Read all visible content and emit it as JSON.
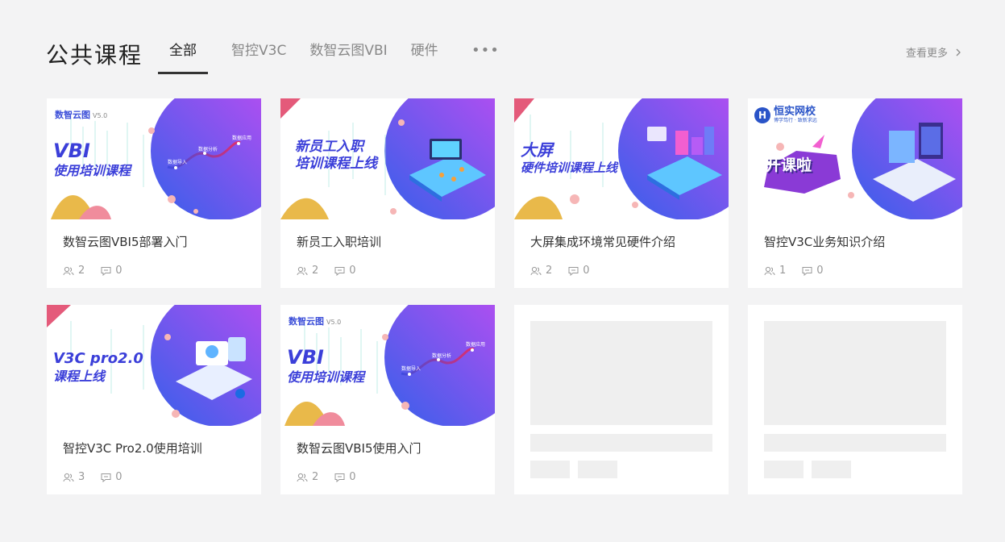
{
  "header": {
    "title": "公共课程",
    "tabs": [
      {
        "label": "全部",
        "active": true
      },
      {
        "label": "智控V3C",
        "active": false
      },
      {
        "label": "数智云图VBI",
        "active": false
      },
      {
        "label": "硬件",
        "active": false
      }
    ],
    "more_tabs": "•••",
    "view_more": "查看更多"
  },
  "courses": [
    {
      "title": "数智云图VBI5部署入门",
      "learners": "2",
      "comments": "0",
      "cover": {
        "brand": "数智云图",
        "brand_version": "V5.0",
        "line1": "VBI",
        "line2": "使用培训课程",
        "chart_labels": [
          "数据导入",
          "数据分析",
          "数据应用"
        ]
      }
    },
    {
      "title": "新员工入职培训",
      "learners": "2",
      "comments": "0",
      "cover": {
        "line1": "新员工入职",
        "line2": "培训课程上线"
      }
    },
    {
      "title": "大屏集成环境常见硬件介绍",
      "learners": "2",
      "comments": "0",
      "cover": {
        "line1": "大屏",
        "line2": "硬件培训课程上线"
      }
    },
    {
      "title": "智控V3C业务知识介绍",
      "learners": "1",
      "comments": "0",
      "cover": {
        "school_name": "恒实网校",
        "school_slogan": "博学笃行 · 致新求远",
        "line1": "开课啦"
      }
    },
    {
      "title": "智控V3C Pro2.0使用培训",
      "learners": "3",
      "comments": "0",
      "cover": {
        "line1": "V3C pro2.0",
        "line2": "课程上线"
      }
    },
    {
      "title": "数智云图VBI5使用入门",
      "learners": "2",
      "comments": "0",
      "cover": {
        "brand": "数智云图",
        "brand_version": "V5.0",
        "line1": "VBI",
        "line2": "使用培训课程",
        "chart_labels": [
          "数据导入",
          "数据分析",
          "数据应用"
        ]
      }
    }
  ],
  "colors": {
    "accent_gradient_start": "#3b5ce8",
    "accent_gradient_end": "#b14cf0",
    "cover_text": "#3b3fd9",
    "page_bg": "#f3f3f4"
  },
  "icons": {
    "learners": "users-icon",
    "comments": "comment-icon",
    "view_more": "chevron-right-icon"
  }
}
